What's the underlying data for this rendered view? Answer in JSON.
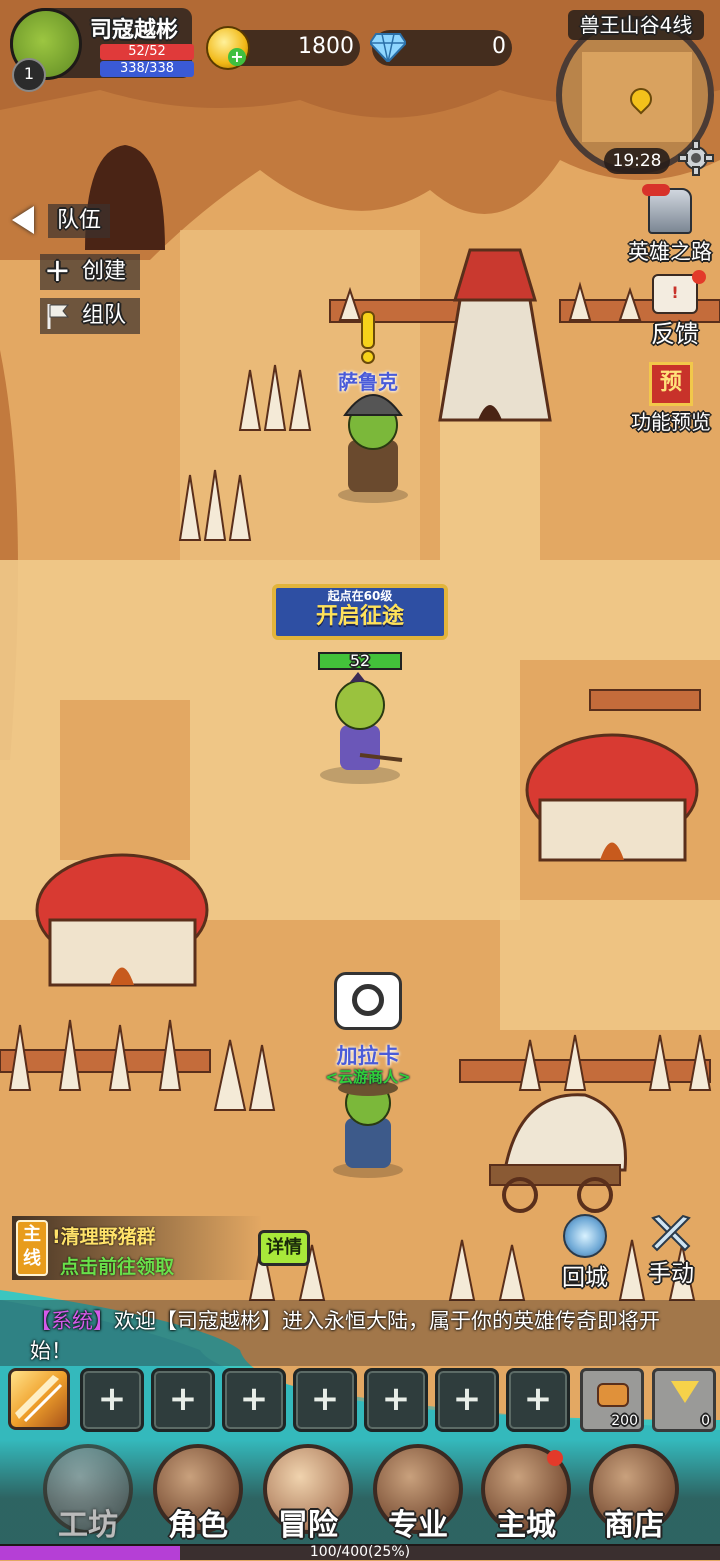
{
  "player": {
    "name": "司寇越彬",
    "level": "1",
    "hp": "52/52",
    "mp": "338/338",
    "hp_fraction": 1.0,
    "mp_fraction": 1.0
  },
  "currency": {
    "gold": "1800",
    "diamond": "0"
  },
  "minimap": {
    "zone": "兽王山谷4线",
    "time": "19:28"
  },
  "right_menu": {
    "hero_road": "英雄之路",
    "feedback": "反馈",
    "preview_badge": "预",
    "preview": "功能预览"
  },
  "team": {
    "title": "队伍",
    "create": "创建",
    "group": "组队"
  },
  "npcs": {
    "saruk": "萨鲁克",
    "galaka": "加拉卡",
    "galaka_title": "<云游商人>"
  },
  "banner": {
    "line1": "起点在60级",
    "line2": "开启征途"
  },
  "hero": {
    "level_tag": "52"
  },
  "quest": {
    "type_line1": "主",
    "type_line2": "线",
    "name": "!清理野猪群",
    "hint": "点击前往领取",
    "detail_button": "详情"
  },
  "actions": {
    "return_city": "回城",
    "manual": "手动"
  },
  "chat": {
    "channel": "【系统】",
    "message": "欢迎【司寇越彬】进入永恒大陆，属于你的英雄传奇即将开始！"
  },
  "skills": {
    "empty_slot": "+",
    "item1_count": "200",
    "item2_count": "0"
  },
  "bottom_nav": [
    {
      "label": "工坊"
    },
    {
      "label": "角色"
    },
    {
      "label": "冒险"
    },
    {
      "label": "专业"
    },
    {
      "label": "主城"
    },
    {
      "label": "商店"
    }
  ],
  "exp": {
    "text": "100/400(25%)",
    "fraction": 0.25
  },
  "colors": {
    "ground": "#e3a863",
    "path": "#f0c98a",
    "cliff": "#c27a3e",
    "water": "#3cc6c0",
    "hp_bar": "#e03a3a",
    "mp_bar": "#3a5ad6",
    "npc_name": "#4a5bd8",
    "quest_hint": "#69e04a",
    "exp_fill": "#b53fd6"
  }
}
